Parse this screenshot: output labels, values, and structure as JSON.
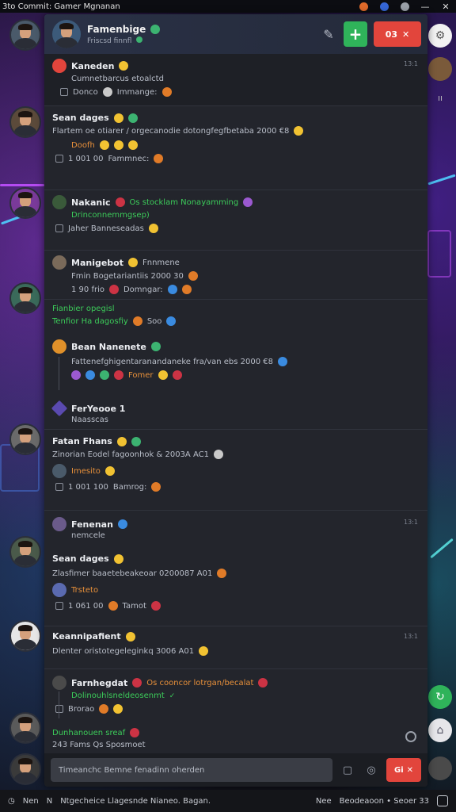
{
  "titlebar": {
    "title": "3to Commit: Gamer Mgnanan",
    "minimize": "—",
    "close": "✕"
  },
  "header": {
    "title": "Famenbige",
    "subtitle": "Friscsd finnfl",
    "red_button": "03"
  },
  "messages": [
    {
      "name": "Kaneden",
      "text": "Cumnetbarcus etoalctd",
      "meta": "Donco",
      "meta2": "Immange:",
      "time": "13:1"
    },
    {
      "name": "Sean dages",
      "text": "Flartem oe otiarer / orgecanodie dotongfegfbetaba 2000 €8",
      "reacts": "Doofh",
      "meta": "1 001 00",
      "meta2": "Fammnec:"
    },
    {
      "name": "Nakanic",
      "tag": "Os  stocklam  Nonayamming",
      "sub": "Drinconnemmgsep)",
      "meta": "Jaher Banneseadas"
    },
    {
      "name": "Manigebot",
      "tag": "Fnnmene",
      "text": "Fmin Bogetariantiis 2000 30",
      "meta": "1 90 frio",
      "meta2": "Domngar:"
    },
    {
      "green1": "Fianbier opegisl",
      "green2": "Tenfior Ha dagosfiy",
      "green3": "Soo"
    },
    {
      "name": "Bean Nanenete",
      "text": "Fattenefghigentaranandaneke fra/van ebs 2000 €8",
      "meta": "Fomer"
    },
    {
      "name": "FerYeooe 1",
      "sub": "Naasscas"
    },
    {
      "name": "Fatan Fhans",
      "text": "Zinorian Eodel fagoonhok & 2003A AC1",
      "reacts": "Imesito",
      "meta": "1 001 100",
      "meta2": "Bamrog:"
    },
    {
      "name": "Fenenan",
      "sub": "nemcele",
      "time": "13:1"
    },
    {
      "name": "Sean dages",
      "text": "Zlasfimer baaetebeakeoar 0200087 A01",
      "reacts": "Trsteto",
      "meta": "1 061 00",
      "meta2": "Tamot"
    },
    {
      "name": "Keannipafient",
      "text": "Dlenter oristotegeleginkq 3006 A01",
      "time": "13:1"
    },
    {
      "name": "Farnhegdat",
      "tag": "Os  cooncor lotrgan/becalat",
      "sub": "Dolinouhlsneldeosenmt",
      "meta": "Brorao",
      "check": "✓"
    },
    {
      "green1": "Dunhanouen sreaf",
      "sub": "243 Fams  Qs  Sposmoet"
    }
  ],
  "composer": {
    "placeholder": "Timeanchc Bemne fenadinn oherden",
    "send_label": "Gi"
  },
  "statusbar": {
    "left": "Nen",
    "mid1": "N",
    "mid2": "Ntgecheice Llagesnde Nianeo. Bagan.",
    "right1": "Nee",
    "right2": "Beodeaoon • Seoer 33"
  },
  "colors": {
    "accent_green": "#2fb35a",
    "accent_red": "#e2453c",
    "panel_bg": "#23252c"
  }
}
